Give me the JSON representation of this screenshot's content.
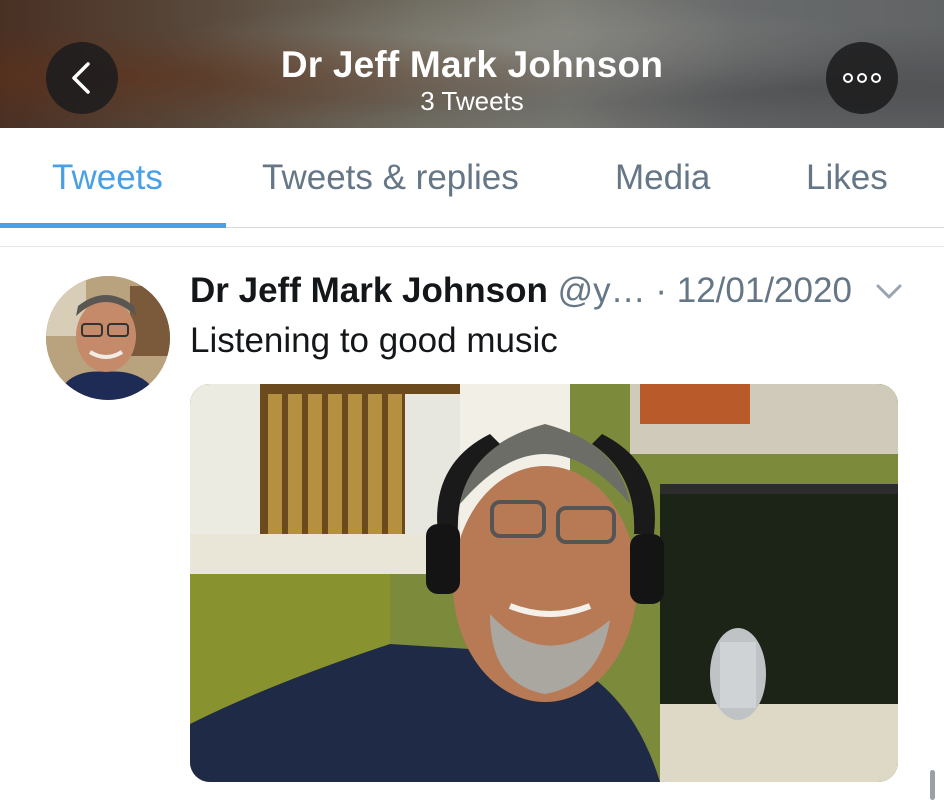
{
  "header": {
    "title": "Dr Jeff Mark Johnson",
    "subtitle": "3 Tweets",
    "back_icon": "chevron-left-icon",
    "more_icon": "more-dots-icon"
  },
  "tabs": [
    {
      "label": "Tweets",
      "active": true
    },
    {
      "label": "Tweets & replies",
      "active": false
    },
    {
      "label": "Media",
      "active": false
    },
    {
      "label": "Likes",
      "active": false
    }
  ],
  "tweet": {
    "name": "Dr Jeff Mark Johnson",
    "handle": "@y…",
    "separator": "·",
    "date": "12/01/2020",
    "text": "Listening to good music",
    "menu_icon": "chevron-down-icon"
  },
  "colors": {
    "accent": "#4aa0e6",
    "secondary_text": "#657786",
    "primary_text": "#14171a"
  }
}
